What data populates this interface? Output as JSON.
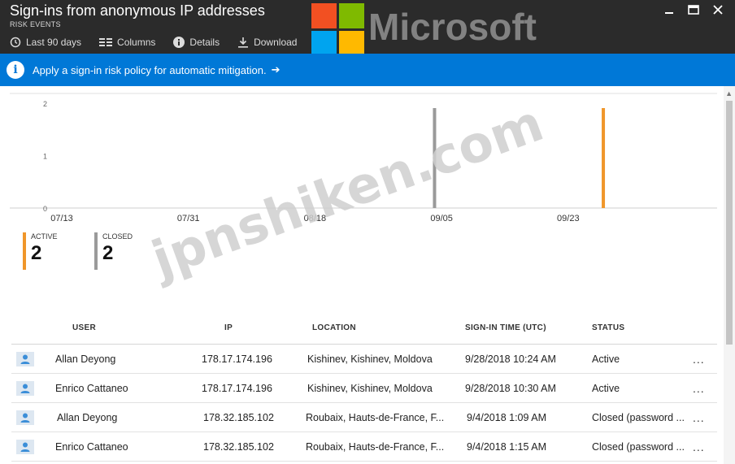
{
  "header": {
    "title": "Sign-ins from anonymous IP addresses",
    "subtitle": "RISK EVENTS",
    "toolbar": [
      {
        "label": "Last 90 days",
        "icon": "history-icon"
      },
      {
        "label": "Columns",
        "icon": "columns-icon"
      },
      {
        "label": "Details",
        "icon": "info-icon"
      },
      {
        "label": "Download",
        "icon": "download-icon"
      }
    ]
  },
  "logo": {
    "text": "Microsoft",
    "colors": [
      "#f25022",
      "#7fba00",
      "#00a4ef",
      "#ffb900"
    ]
  },
  "banner": {
    "text": "Apply a sign-in risk policy for automatic mitigation.",
    "arrow": "➔"
  },
  "chart_data": {
    "type": "bar",
    "categories": [
      "09/05",
      "09/28"
    ],
    "series": [
      {
        "name": "CLOSED",
        "color": "#9a9a9a",
        "x": [
          "09/04"
        ],
        "values": [
          2
        ]
      },
      {
        "name": "ACTIVE",
        "color": "#f0962a",
        "x": [
          "09/28"
        ],
        "values": [
          2
        ]
      }
    ],
    "x_ticks": [
      "07/13",
      "07/31",
      "08/18",
      "09/05",
      "09/23"
    ],
    "y_ticks": [
      "2",
      "1",
      "0"
    ],
    "ylim": [
      0,
      2
    ],
    "grid": false
  },
  "legend": {
    "active": {
      "label": "ACTIVE",
      "value": "2",
      "color": "#f0962a"
    },
    "closed": {
      "label": "CLOSED",
      "value": "2",
      "color": "#9a9a9a"
    }
  },
  "table": {
    "columns": [
      "USER",
      "IP",
      "LOCATION",
      "SIGN-IN TIME (UTC)",
      "STATUS"
    ],
    "rows": [
      {
        "user": "Allan Deyong",
        "ip": "178.17.174.196",
        "location": "Kishinev, Kishinev, Moldova",
        "time": "9/28/2018 10:24 AM",
        "status": "Active"
      },
      {
        "user": "Enrico Cattaneo",
        "ip": "178.17.174.196",
        "location": "Kishinev, Kishinev, Moldova",
        "time": "9/28/2018 10:30 AM",
        "status": "Active"
      },
      {
        "user": "Allan Deyong",
        "ip": "178.32.185.102",
        "location": "Roubaix, Hauts-de-France, F...",
        "time": "9/4/2018 1:09 AM",
        "status": "Closed (password ..."
      },
      {
        "user": "Enrico Cattaneo",
        "ip": "178.32.185.102",
        "location": "Roubaix, Hauts-de-France, F...",
        "time": "9/4/2018 1:15 AM",
        "status": "Closed (password ..."
      }
    ],
    "more_label": "..."
  },
  "watermark": "jpnshiken.com"
}
